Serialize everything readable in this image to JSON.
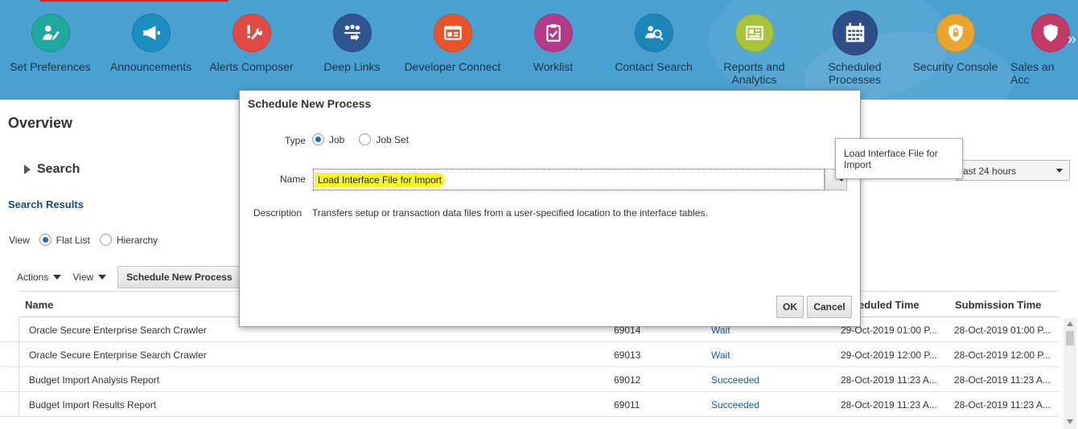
{
  "launcher": {
    "tiles": [
      {
        "label": "Set Preferences",
        "icon": "set-preferences-icon",
        "color": "#1fa9a0"
      },
      {
        "label": "Announcements",
        "icon": "megaphone-icon",
        "color": "#1b8fc1"
      },
      {
        "label": "Alerts Composer",
        "icon": "alert-wrench-icon",
        "color": "#e24a44"
      },
      {
        "label": "Deep Links",
        "icon": "deep-links-icon",
        "color": "#2f5690"
      },
      {
        "label": "Developer Connect",
        "icon": "developer-connect-icon",
        "color": "#e8542c"
      },
      {
        "label": "Worklist",
        "icon": "clipboard-check-icon",
        "color": "#b43b8a"
      },
      {
        "label": "Contact Search",
        "icon": "contact-search-icon",
        "color": "#1c86b8"
      },
      {
        "label": "Reports and Analytics",
        "icon": "reports-icon",
        "color": "#a8c43c"
      },
      {
        "label": "Scheduled Processes",
        "icon": "calendar-icon",
        "color": "#2f4e88"
      },
      {
        "label": "Security Console",
        "icon": "shield-lock-icon",
        "color": "#e9a530"
      },
      {
        "label": "Sales an Acc",
        "icon": "sales-icon",
        "color": "#c23a68"
      }
    ]
  },
  "page": {
    "title": "Overview",
    "search_label": "Search",
    "search_results_label": "Search Results",
    "view_label": "View",
    "view_flat_list": "Flat List",
    "view_hierarchy": "Hierarchy",
    "actions_label": "Actions",
    "view_menu_label": "View",
    "schedule_button": "Schedule New Process",
    "time_filter": "ast 24 hours"
  },
  "table": {
    "columns": {
      "name": "Name",
      "scheduled_time": "eduled Time",
      "submission_time": "Submission Time"
    },
    "rows": [
      {
        "name": "Oracle Secure Enterprise Search Crawler",
        "id": "69014",
        "status": "Wait",
        "scheduled": "29-Oct-2019 01:00 P...",
        "submitted": "28-Oct-2019 01:00 P..."
      },
      {
        "name": "Oracle Secure Enterprise Search Crawler",
        "id": "69013",
        "status": "Wait",
        "scheduled": "29-Oct-2019 12:00 P...",
        "submitted": "28-Oct-2019 12:00 P..."
      },
      {
        "name": "Budget Import Analysis Report",
        "id": "69012",
        "status": "Succeeded",
        "scheduled": "28-Oct-2019 11:23 A...",
        "submitted": "28-Oct-2019 11:23 A..."
      },
      {
        "name": "Budget Import Results Report",
        "id": "69011",
        "status": "Succeeded",
        "scheduled": "28-Oct-2019 11:23 A...",
        "submitted": "28-Oct-2019 11:23 A..."
      }
    ]
  },
  "dialog": {
    "title": "Schedule New Process",
    "type_label": "Type",
    "type_job": "Job",
    "type_job_set": "Job Set",
    "name_label": "Name",
    "name_value": "Load Interface File for Import",
    "description_label": "Description",
    "description_value": "Transfers setup or transaction data files from a user-specified location to the interface tables.",
    "ok_label": "OK",
    "cancel_label": "Cancel"
  },
  "tooltip": {
    "text": "Load Interface File for Import"
  },
  "colors": {
    "launcher_bg": "#4aa0d0",
    "link": "#1d5c8c",
    "highlight": "#f7f52a",
    "radio_selected": "#1a6bc4"
  }
}
